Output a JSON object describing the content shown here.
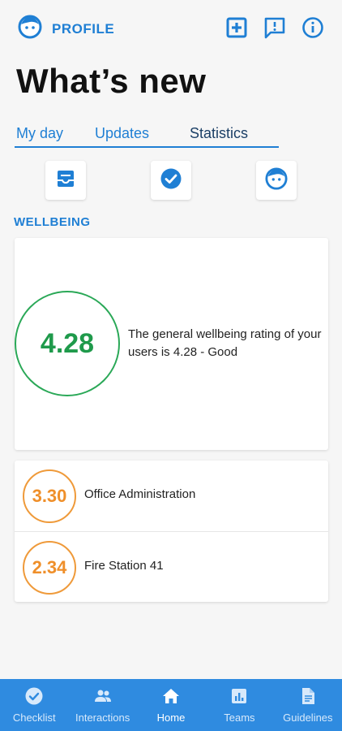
{
  "header": {
    "profile_label": "PROFILE",
    "icons": [
      "face-icon",
      "add-box-icon",
      "feedback-icon",
      "info-icon"
    ]
  },
  "page": {
    "title": "What’s new"
  },
  "tabs": [
    {
      "label": "My day",
      "active": false
    },
    {
      "label": "Updates",
      "active": false
    },
    {
      "label": "Statistics",
      "active": true
    }
  ],
  "stat_icons": [
    "inbox-icon",
    "check-circle-icon",
    "face-icon"
  ],
  "wellbeing": {
    "section_title": "WELLBEING",
    "overall_score": "4.28",
    "description": "The general wellbeing rating of your users is 4.28 - Good",
    "teams": [
      {
        "score": "3.30",
        "name": "Office Administration"
      },
      {
        "score": "2.34",
        "name": "Fire Station 41"
      }
    ]
  },
  "nav": [
    {
      "label": "Checklist",
      "icon": "checklist-icon",
      "active": false
    },
    {
      "label": "Interactions",
      "icon": "people-icon",
      "active": false
    },
    {
      "label": "Home",
      "icon": "home-icon",
      "active": true
    },
    {
      "label": "Teams",
      "icon": "chart-icon",
      "active": false
    },
    {
      "label": "Guidelines",
      "icon": "document-icon",
      "active": false
    }
  ],
  "colors": {
    "accent": "#1f7fd4",
    "nav_bg": "#2f8be0",
    "good": "#1f9a4b",
    "warning": "#ef8f2a"
  }
}
